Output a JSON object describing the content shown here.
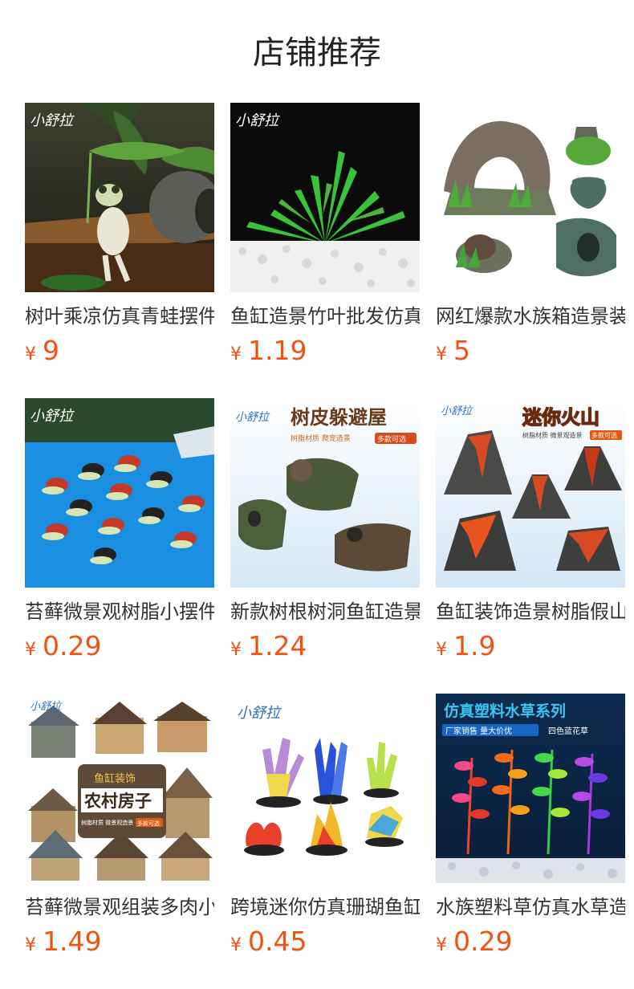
{
  "section": {
    "title": "店铺推荐"
  },
  "brand_logo_text": "小舒拉",
  "colors": {
    "price": "#f25314",
    "title": "#222222",
    "product_name": "#333333"
  },
  "products": [
    {
      "name": "树叶乘凉仿真青蛙摆件",
      "currency": "¥",
      "price": "9",
      "image_icon": "frog-ornament-image"
    },
    {
      "name": "鱼缸造景竹叶批发仿真",
      "currency": "¥",
      "price": "1.19",
      "image_icon": "fern-plant-image"
    },
    {
      "name": "网红爆款水族箱造景装",
      "currency": "¥",
      "price": "5",
      "image_icon": "ruins-vase-image"
    },
    {
      "name": "苔藓微景观树脂小摆件",
      "currency": "¥",
      "price": "0.29",
      "image_icon": "turtles-image"
    },
    {
      "name": "新款树根树洞鱼缸造景",
      "currency": "¥",
      "price": "1.24",
      "image_icon": "bark-shelter-image",
      "banner": "树皮躲避屋",
      "subbanner": "树脂材质 爬宠造景",
      "tag": "多款可选"
    },
    {
      "name": "鱼缸装饰造景树脂假山",
      "currency": "¥",
      "price": "1.9",
      "image_icon": "volcano-image",
      "banner": "迷你火山",
      "subbanner": "树脂材质 微景观造景",
      "tag": "多款可选"
    },
    {
      "name": "苔藓微景观组装多肉小",
      "currency": "¥",
      "price": "1.49",
      "image_icon": "village-house-image",
      "banner_top": "鱼缸装饰",
      "banner": "农村房子",
      "subbanner": "树脂材质 微景观造景",
      "tag": "多款可选"
    },
    {
      "name": "跨境迷你仿真珊瑚鱼缸",
      "currency": "¥",
      "price": "0.45",
      "image_icon": "coral-image"
    },
    {
      "name": "水族塑料草仿真水草造",
      "currency": "¥",
      "price": "0.29",
      "image_icon": "plastic-plant-image",
      "banner": "仿真塑料水草系列",
      "subbanner": "厂家销售 量大价优",
      "tag": "四色蓝花草"
    }
  ]
}
